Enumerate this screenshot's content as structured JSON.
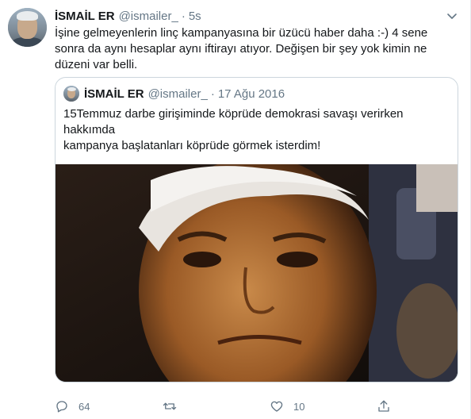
{
  "tweet": {
    "author_name": "İSMAİL ER",
    "author_handle": "@ismailer_",
    "separator": "·",
    "time": "5s",
    "text": "İşine gelmeyenlerin linç kampanyasına bir üzücü haber daha :-) 4 sene sonra da aynı hesaplar aynı iftirayı atıyor. Değişen bir şey yok kimin ne düzeni var belli."
  },
  "quoted": {
    "author_name": "İSMAİL ER",
    "author_handle": "@ismailer_",
    "separator": "·",
    "date": "17 Ağu 2016",
    "text_line1": "15Temmuz darbe girişiminde köprüde demokrasi savaşı verirken hakkımda",
    "text_line2": "kampanya başlatanları köprüde görmek isterdim!"
  },
  "actions": {
    "reply_count": "64",
    "retweet_count": "",
    "like_count": "10"
  },
  "icons": [
    "chevron-down-icon",
    "reply-icon",
    "retweet-icon",
    "like-icon",
    "share-icon"
  ],
  "colors": {
    "text": "#14171a",
    "secondary": "#657786",
    "border": "#ccd6dd"
  }
}
